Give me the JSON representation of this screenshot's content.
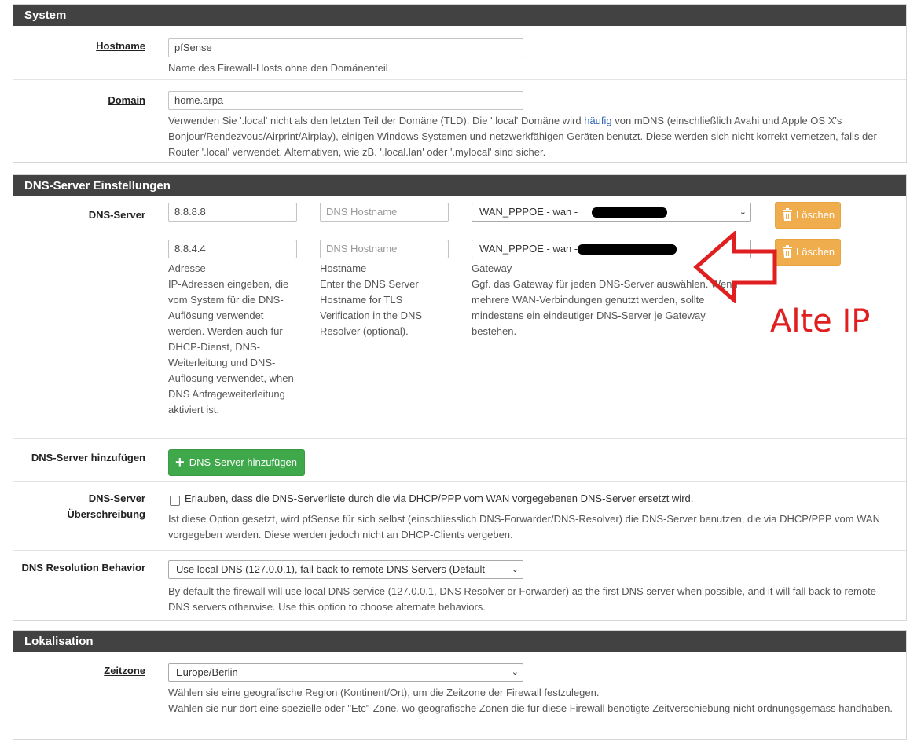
{
  "system": {
    "heading": "System",
    "hostname": {
      "label": "Hostname",
      "value": "pfSense",
      "help": "Name des Firewall-Hosts ohne den Domänenteil"
    },
    "domain": {
      "label": "Domain",
      "value": "home.arpa",
      "help_before_link": "Verwenden Sie '.local' nicht als den letzten Teil der Domäne (TLD). Die '.local' Domäne wird ",
      "help_link": "häufig",
      "help_after_link": " von mDNS (einschließlich Avahi und Apple OS X's Bonjour/Rendezvous/Airprint/Airplay), einigen Windows Systemen und netzwerkfähigen Geräten benutzt. Diese werden sich nicht korrekt vernetzen, falls der Router '.local' verwendet. Alternativen, wie zB. '.local.lan' oder '.mylocal' sind sicher."
    }
  },
  "dns": {
    "heading": "DNS-Server Einstellungen",
    "server_label": "DNS-Server",
    "rows": [
      {
        "address": "8.8.8.8",
        "hostname_placeholder": "DNS Hostname",
        "gateway": "WAN_PPPOE - wan - ",
        "delete_label": "Löschen"
      },
      {
        "address": "8.8.4.4",
        "hostname_placeholder": "DNS Hostname",
        "gateway": "WAN_PPPOE - wan - ",
        "delete_label": "Löschen"
      }
    ],
    "address_help_title": "Adresse",
    "address_help": "IP-Adressen eingeben, die vom System für die DNS-Auflösung verwendet werden. Werden auch für DHCP-Dienst, DNS-Weiterleitung und DNS-Auflösung verwendet, when DNS Anfrageweiterleitung aktiviert ist.",
    "hostname_help_title": "Hostname",
    "hostname_help": "Enter the DNS Server Hostname for TLS Verification in the DNS Resolver (optional).",
    "gateway_help_title": "Gateway",
    "gateway_help": "Ggf. das Gateway für jeden DNS-Server auswählen. Wenn mehrere WAN-Verbindungen genutzt werden, sollte mindestens ein eindeutiger DNS-Server je Gateway bestehen.",
    "add_label": "DNS-Server hinzufügen",
    "add_button": "DNS-Server hinzufügen",
    "override_label_1": "DNS-Server",
    "override_label_2": "Überschreibung",
    "override_checkbox": "Erlauben, dass die DNS-Serverliste durch die via DHCP/PPP vom WAN vorgegebenen DNS-Server ersetzt wird.",
    "override_help": "Ist diese Option gesetzt, wird pfSense für sich selbst (einschliesslich DNS-Forwarder/DNS-Resolver) die DNS-Server benutzen, die via DHCP/PPP vom WAN vorgegeben werden. Diese werden jedoch nicht an DHCP-Clients vergeben.",
    "resolution_label": "DNS Resolution Behavior",
    "resolution_value": "Use local DNS (127.0.0.1), fall back to remote DNS Servers (Default",
    "resolution_help": "By default the firewall will use local DNS service (127.0.0.1, DNS Resolver or Forwarder) as the first DNS server when possible, and it will fall back to remote DNS servers otherwise. Use this option to choose alternate behaviors."
  },
  "localisation": {
    "heading": "Lokalisation",
    "timezone_label": "Zeitzone",
    "timezone_value": "Europe/Berlin",
    "timezone_help_1": "Wählen sie eine geografische Region (Kontinent/Ort), um die Zeitzone der Firewall festzulegen.",
    "timezone_help_2": "Wählen sie nur dort eine spezielle oder \"Etc\"-Zone, wo geografische Zonen die für diese Firewall benötigte Zeitverschiebung nicht ordnungsgemäss handhaben."
  },
  "annotation": {
    "text": "Alte IP",
    "color": "#e02020"
  },
  "colors": {
    "heading_bg": "#424242",
    "delete_button": "#f0ad4e",
    "add_button": "#3fa84a",
    "link": "#2c64b4"
  }
}
